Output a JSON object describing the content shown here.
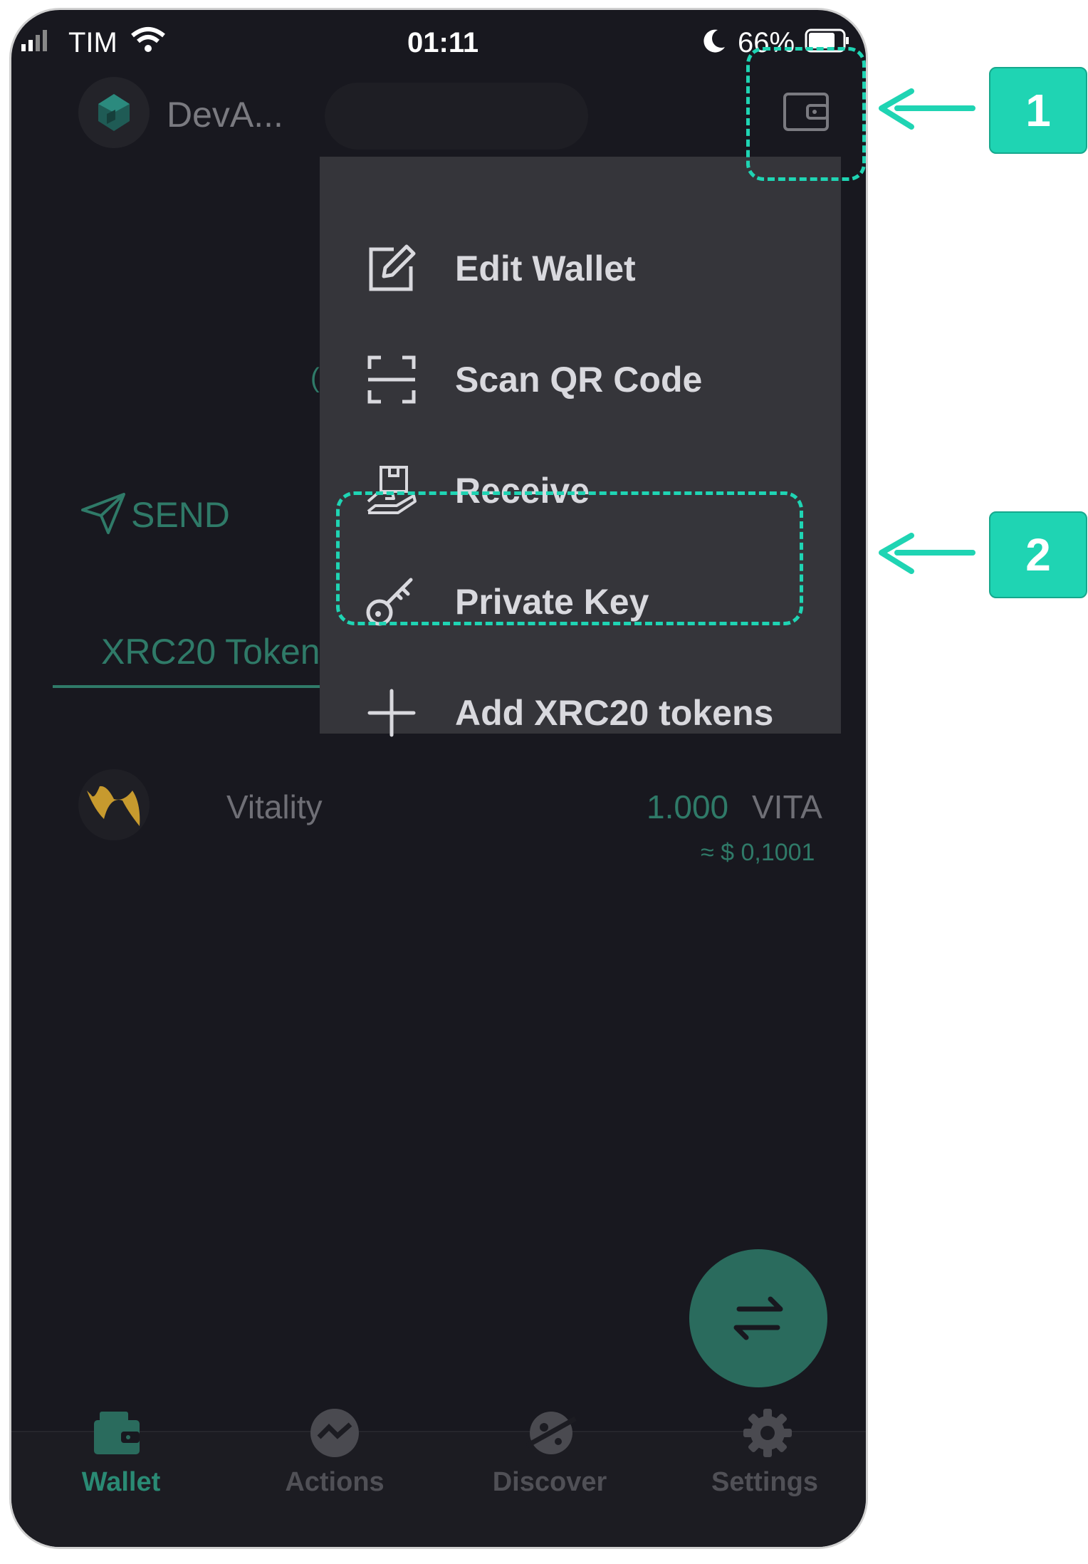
{
  "status_bar": {
    "carrier": "TIM",
    "time": "01:11",
    "battery": "66%"
  },
  "header": {
    "wallet_name": "DevA..."
  },
  "actions": {
    "send_label": "SEND",
    "hidden_fragment": "("
  },
  "tabs": {
    "active_label": "XRC20 Token"
  },
  "menu": {
    "items": [
      {
        "label": "Edit Wallet",
        "icon": "edit-icon"
      },
      {
        "label": "Scan QR Code",
        "icon": "scan-qr-icon"
      },
      {
        "label": "Receive",
        "icon": "receive-icon"
      },
      {
        "label": "Private Key",
        "icon": "key-icon"
      },
      {
        "label": "Add XRC20 tokens",
        "icon": "plus-icon"
      }
    ]
  },
  "tokens": [
    {
      "name": "Vitality",
      "amount": "1.000",
      "symbol": "VITA",
      "fiat": "≈ $ 0,1001"
    }
  ],
  "bottom_nav": [
    {
      "label": "Wallet",
      "icon": "wallet-icon",
      "active": true
    },
    {
      "label": "Actions",
      "icon": "actions-icon",
      "active": false
    },
    {
      "label": "Discover",
      "icon": "discover-icon",
      "active": false
    },
    {
      "label": "Settings",
      "icon": "gear-icon",
      "active": false
    }
  ],
  "callouts": [
    "1",
    "2"
  ],
  "colors": {
    "accent": "#1fd4b3",
    "background": "#18181f",
    "menu": "#35353a"
  }
}
